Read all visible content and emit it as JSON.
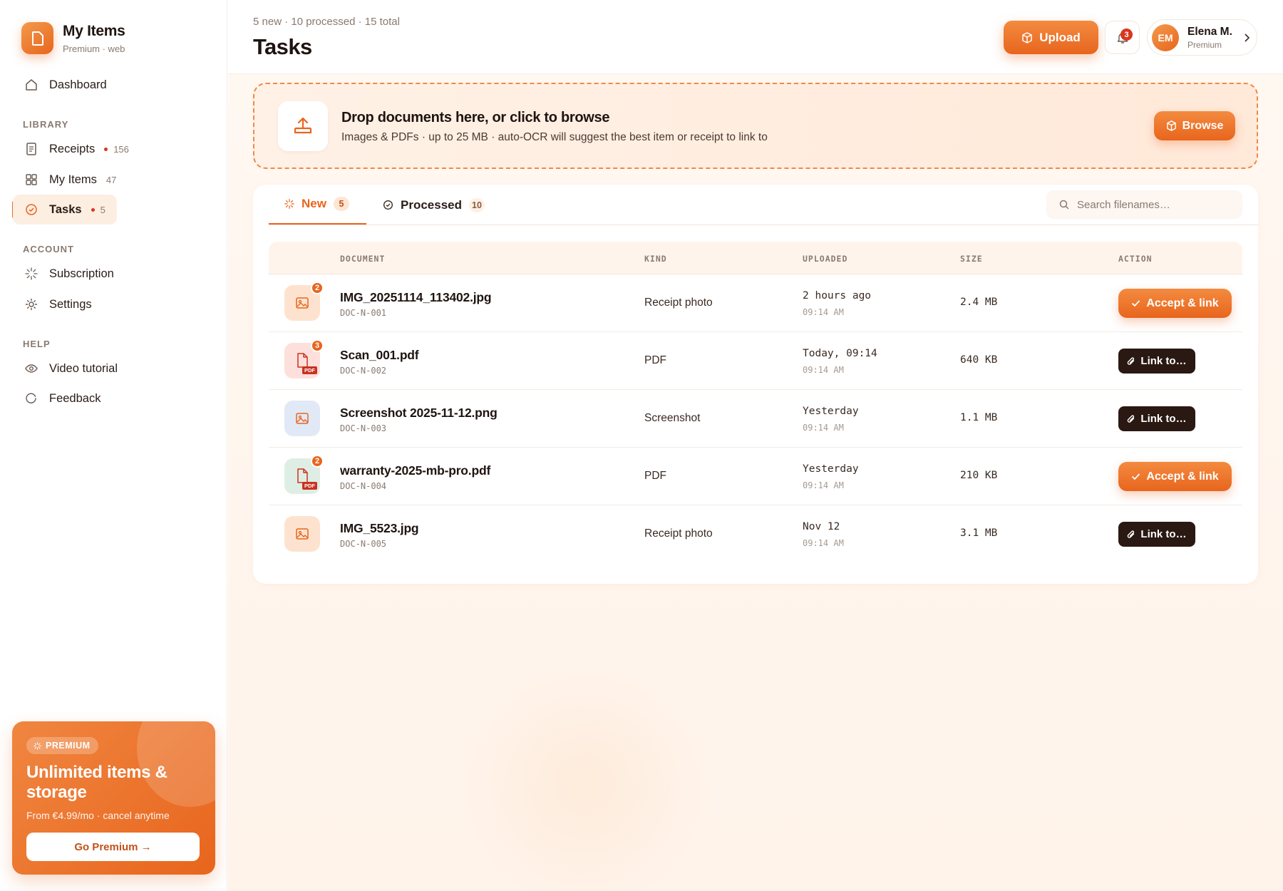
{
  "brand": {
    "name": "My Items",
    "subtitle": "Premium · web"
  },
  "sidebar": {
    "dashboard": "Dashboard",
    "library_label": "LIBRARY",
    "receipts": {
      "label": "Receipts",
      "count": "156"
    },
    "my_items": {
      "label": "My Items",
      "count": "47"
    },
    "tasks": {
      "label": "Tasks",
      "count": "5"
    },
    "account_label": "ACCOUNT",
    "subscription": "Subscription",
    "settings": "Settings",
    "help_label": "HELP",
    "video_tutorial": "Video tutorial",
    "feedback": "Feedback"
  },
  "promo": {
    "badge": "PREMIUM",
    "title": "Unlimited items & storage",
    "subtitle": "From €4.99/mo · cancel anytime",
    "button": "Go Premium →"
  },
  "header": {
    "stats": "5 new · 10 processed · 15 total",
    "title": "Tasks",
    "upload": "Upload",
    "notifications": "3",
    "user": {
      "initials": "EM",
      "name": "Elena M.",
      "plan": "Premium"
    }
  },
  "dropzone": {
    "title": "Drop documents here, or click to browse",
    "subtitle": "Images & PDFs · up to 25 MB · auto-OCR will suggest the best item or receipt to link to",
    "browse": "Browse"
  },
  "tabs": [
    {
      "label": "New",
      "count": "5"
    },
    {
      "label": "Processed",
      "count": "10"
    }
  ],
  "search": {
    "placeholder": "Search filenames…"
  },
  "table": {
    "columns": [
      "DOCUMENT",
      "KIND",
      "UPLOADED",
      "SIZE",
      "ACTION"
    ],
    "rows": [
      {
        "name": "IMG_20251114_113402.jpg",
        "id": "DOC-N-001",
        "kind": "Receipt photo",
        "uploaded": "2 hours ago",
        "time": "09:14 AM",
        "size": "2.4 MB",
        "action": "Accept & link",
        "badge": "2"
      },
      {
        "name": "Scan_001.pdf",
        "id": "DOC-N-002",
        "kind": "PDF",
        "uploaded": "Today, 09:14",
        "time": "09:14 AM",
        "size": "640 KB",
        "action": "Link to…",
        "badge": "3",
        "tag": "PDF"
      },
      {
        "name": "Screenshot 2025-11-12.png",
        "id": "DOC-N-003",
        "kind": "Screenshot",
        "uploaded": "Yesterday",
        "time": "09:14 AM",
        "size": "1.1 MB",
        "action": "Link to…"
      },
      {
        "name": "warranty-2025-mb-pro.pdf",
        "id": "DOC-N-004",
        "kind": "PDF",
        "uploaded": "Yesterday",
        "time": "09:14 AM",
        "size": "210 KB",
        "action": "Accept & link",
        "badge": "2",
        "tag": "PDF"
      },
      {
        "name": "IMG_5523.jpg",
        "id": "DOC-N-005",
        "kind": "Receipt photo",
        "uploaded": "Nov 12",
        "time": "09:14 AM",
        "size": "3.1 MB",
        "action": "Link to…"
      }
    ]
  },
  "colors": {
    "accent": "#e8651d",
    "dark_button": "#2a1812",
    "danger": "#d9371e"
  }
}
